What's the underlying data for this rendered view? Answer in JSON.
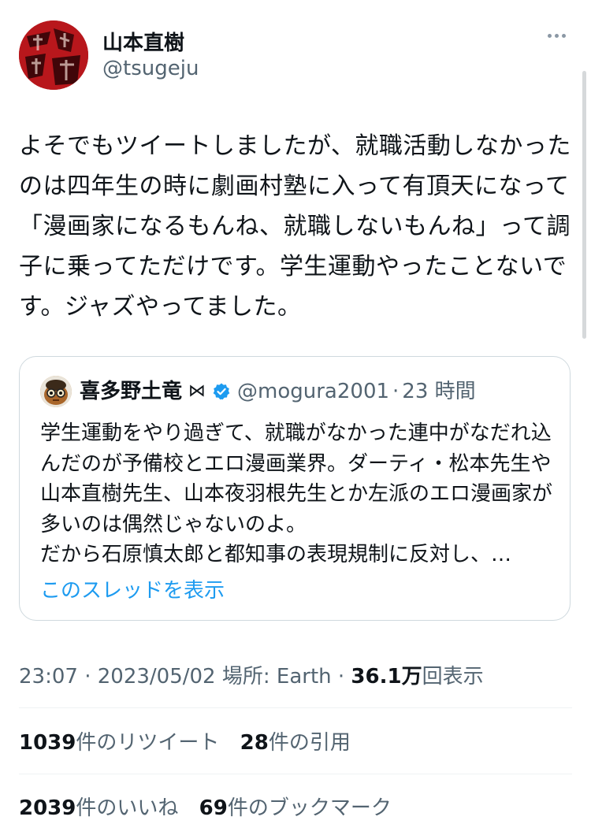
{
  "author": {
    "display_name": "山本直樹",
    "handle": "@tsugeju",
    "avatar_icon": "avatar-red-calligraphy"
  },
  "more_icon": "more-horizontal-icon",
  "tweet": {
    "text": "よそでもツイートしましたが、就職活動しなかったのは四年生の時に劇画村塾に入って有頂天になって「漫画家になるもんね、就職しないもんね」って調子に乗ってただけです。学生運動やったことないです。ジャズやってました。"
  },
  "quote": {
    "display_name": "喜多野土竜",
    "name_symbol": "⋈",
    "verified_icon": "verified-badge-icon",
    "handle": "@mogura2001",
    "separator": "·",
    "time": "23 時間",
    "text": "学生運動をやり過ぎて、就職がなかった連中がなだれ込んだのが予備校とエロ漫画業界。ダーティ・松本先生や山本直樹先生、山本夜羽根先生とか左派のエロ漫画家が多いのは偶然じゃないのよ。\nだから石原慎太郎と都知事の表現規制に反対し、…",
    "show_thread": "このスレッドを表示"
  },
  "meta": {
    "time": "23:07",
    "sep1": " · ",
    "date": "2023/05/02",
    "location_label": " 場所: ",
    "location": "Earth",
    "sep2": " · ",
    "views": "36.1万",
    "views_label": "回表示"
  },
  "stats": {
    "retweets": "1039",
    "retweets_label": "件のリツイート",
    "quotes": "28",
    "quotes_label": "件の引用",
    "likes": "2039",
    "likes_label": "件のいいね",
    "bookmarks": "69",
    "bookmarks_label": "件のブックマーク"
  },
  "colors": {
    "link": "#1d9bf0",
    "secondary_text": "#536471",
    "border": "#cfd9de",
    "avatar_red": "#b3161b"
  }
}
